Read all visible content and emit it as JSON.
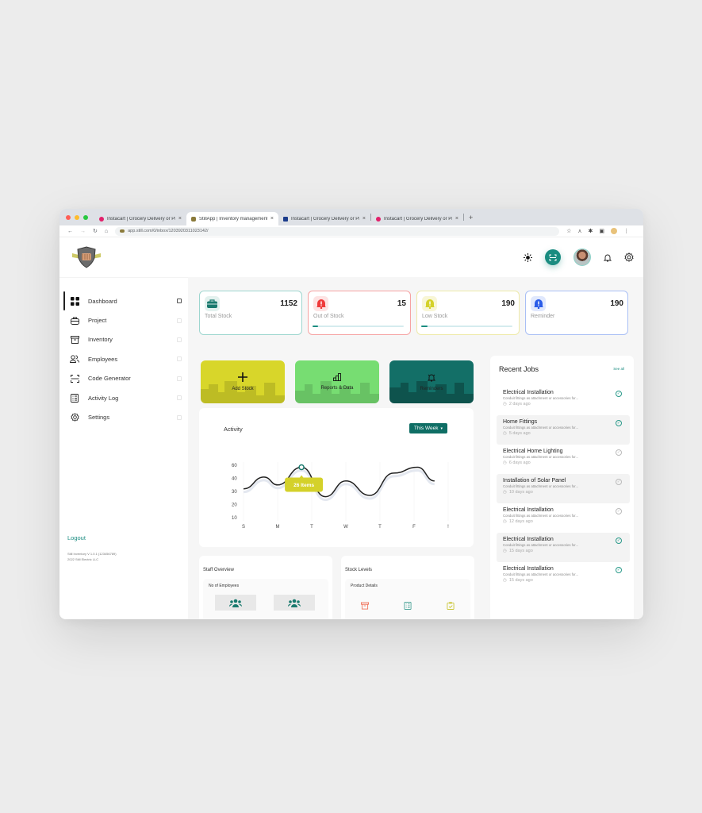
{
  "browser": {
    "tabs": [
      {
        "title": "Instacart | Grocery Delivery or Pickup",
        "favicon_color": "#e2216b",
        "active": false
      },
      {
        "title": "StillApp | Inventory management",
        "favicon_color": "#8a7a3a",
        "active": true
      },
      {
        "title": "Instacart | Grocery Delivery or Pickup",
        "favicon_color": "#1c3c8c",
        "active": false
      },
      {
        "title": "Instacart | Grocery Delivery or Pickup",
        "favicon_color": "#e2216b",
        "active": false
      }
    ],
    "new_tab_icon": "plus-icon",
    "close_icon": "×",
    "url": "app.still.com/0/inbox/1203920311023142/",
    "nav_icons": [
      "back-icon",
      "forward-icon",
      "reload-icon",
      "home-icon"
    ],
    "right_icons": [
      "star-icon",
      "profile-arrow-icon",
      "extensions-icon",
      "sidepanel-icon",
      "user-icon",
      "menu-icon"
    ]
  },
  "header": {
    "icons": [
      "sun-icon",
      "scan-icon",
      "avatar",
      "bell-icon",
      "gear-icon"
    ]
  },
  "sidebar": {
    "items": [
      {
        "label": "Dashboard",
        "icon": "grid-icon",
        "active": true
      },
      {
        "label": "Project",
        "icon": "briefcase-icon",
        "active": false
      },
      {
        "label": "Inventory",
        "icon": "archive-icon",
        "active": false
      },
      {
        "label": "Employees",
        "icon": "users-icon",
        "active": false
      },
      {
        "label": "Code Generator",
        "icon": "scan-icon",
        "active": false
      },
      {
        "label": "Activity Log",
        "icon": "list-icon",
        "active": false
      },
      {
        "label": "Settings",
        "icon": "gear-icon",
        "active": false
      }
    ],
    "logout_label": "Logout",
    "version_line1": "Still Inventory V 1.0.1 (123456789)",
    "version_line2": "2022 Still Electric LLC"
  },
  "stats": [
    {
      "label": "Total Stock",
      "value": "1152",
      "color": "#1a7a6e",
      "bg": "#e3f1ee",
      "border": "#9dd6cf",
      "icon": "briefcase-icon",
      "progress": null
    },
    {
      "label": "Out of Stock",
      "value": "15",
      "color": "#ef3b3b",
      "bg": "#fde3e3",
      "border": "#f6a3a3",
      "icon": "alert-bell-icon",
      "progress": 0.06
    },
    {
      "label": "Low Stock",
      "value": "190",
      "color": "#d4d12a",
      "bg": "#f8f6d6",
      "border": "#eeeaa8",
      "icon": "alert-bell-icon",
      "progress": 0.07
    },
    {
      "label": "Reminder",
      "value": "190",
      "color": "#2a5ce8",
      "bg": "#e0e8fd",
      "border": "#a9bff5",
      "icon": "alert-bell-icon",
      "progress": null
    }
  ],
  "actions": [
    {
      "label": "Add Stock",
      "icon": "plus-icon",
      "bg": "#d8d62a"
    },
    {
      "label": "Reports & Data",
      "icon": "bar-chart-icon",
      "bg": "#77dd72"
    },
    {
      "label": "Reminders",
      "icon": "bell-icon",
      "bg": "#136f67"
    }
  ],
  "activity": {
    "title": "Activity",
    "filter_label": "This Week",
    "tooltip": "26 Items"
  },
  "chart_data": {
    "type": "line",
    "title": "Activity",
    "categories": [
      "S",
      "M",
      "T",
      "W",
      "T",
      "F",
      "!"
    ],
    "y_ticks": [
      10,
      20,
      30,
      40,
      60
    ],
    "ylim": [
      10,
      60
    ],
    "series": [
      {
        "name": "Activity",
        "x": [
          0,
          0.6,
          1,
          1.7,
          2.4,
          3,
          3.7,
          4.4,
          5.1,
          5.6
        ],
        "values": [
          32,
          42,
          35,
          57,
          26,
          38,
          27,
          48,
          57,
          38
        ]
      }
    ],
    "highlight": {
      "index": 3,
      "label": "26 Items"
    },
    "grid": false
  },
  "staff": {
    "title": "Staff Overview",
    "subtitle": "No of Employees"
  },
  "stock_levels": {
    "title": "Stock Levels",
    "subtitle": "Product Details",
    "icons": [
      "archive-icon",
      "list-icon",
      "clipboard-check-icon"
    ]
  },
  "recent_jobs": {
    "title": "Recent Jobs",
    "see_all": "See all",
    "items": [
      {
        "title": "Electrical Installation",
        "desc": "Conduit fittings as attachment or accessories for...",
        "time": "2 days ago",
        "done": true
      },
      {
        "title": "Home Fittings",
        "desc": "Conduit fittings as attachment or accessories for...",
        "time": "5 days ago",
        "done": true
      },
      {
        "title": "Electrical Home Lighting",
        "desc": "Conduit fittings as attachment or accessories for...",
        "time": "6 days ago",
        "done": false
      },
      {
        "title": "Installation of Solar Panel",
        "desc": "Conduit fittings as attachment or accessories for...",
        "time": "10 days ago",
        "done": false
      },
      {
        "title": "Electrical Installation",
        "desc": "Conduit fittings as attachment or accessories for...",
        "time": "12 days ago",
        "done": false
      },
      {
        "title": "Electrical Installation",
        "desc": "Conduit fittings as attachment or accessories for...",
        "time": "15 days ago",
        "done": true
      },
      {
        "title": "Electrical Installation",
        "desc": "Conduit fittings as attachment or accessories for...",
        "time": "15 days ago",
        "done": true
      }
    ]
  }
}
